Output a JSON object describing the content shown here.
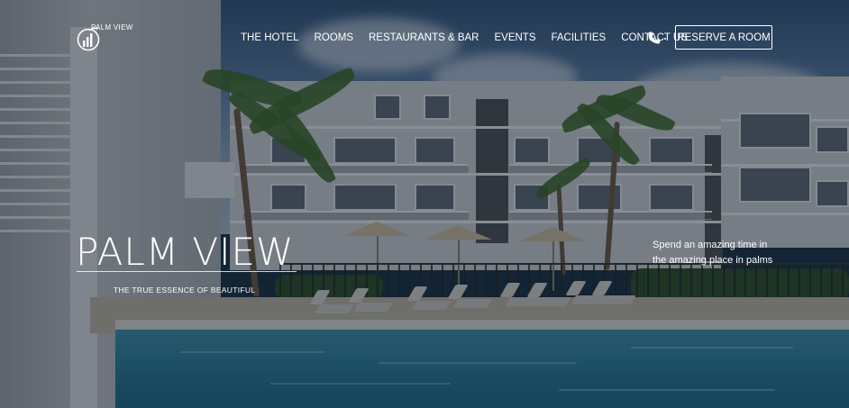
{
  "brand": {
    "name": "PALM VIEW"
  },
  "nav": {
    "items": [
      {
        "label": "THE HOTEL"
      },
      {
        "label": "ROOMS"
      },
      {
        "label": "RESTAURANTS & BAR"
      },
      {
        "label": "EVENTS"
      },
      {
        "label": "FACILITIES"
      },
      {
        "label": "CONTACT US"
      }
    ],
    "phone_icon": "phone-icon",
    "reserve_label": "RESERVE A ROOM"
  },
  "hero": {
    "title": "PALM VIEW",
    "subtitle": "THE TRUE ESSENCE OF BEAUTIFUL",
    "side_line1": "Spend an amazing time in",
    "side_line2": "the amazing place in palms"
  },
  "colors": {
    "overlay": "#08101c",
    "pool": "#2b7a99",
    "text": "#ffffff"
  }
}
